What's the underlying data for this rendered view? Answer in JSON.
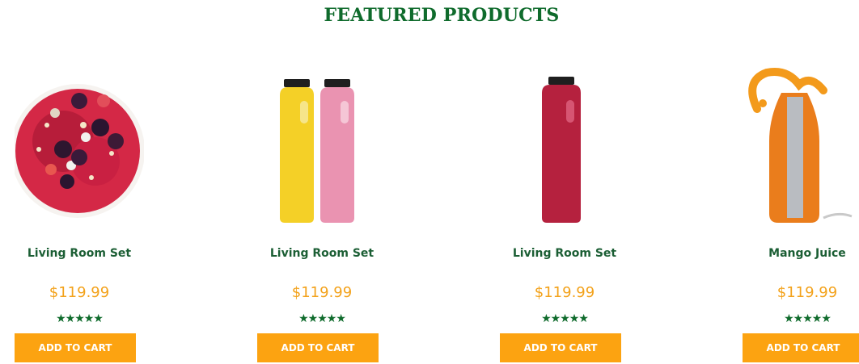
{
  "section": {
    "title": "FEATURED PRODUCTS"
  },
  "products": [
    {
      "name": "Living Room Set",
      "price": "$119.99",
      "rating_stars": 5,
      "rating_display": "★★★★★",
      "cta": "ADD TO CART",
      "image": "berry-smoothie-bowl"
    },
    {
      "name": "Living Room Set",
      "price": "$119.99",
      "rating_stars": 5,
      "rating_display": "★★★★★",
      "cta": "ADD TO CART",
      "image": "yellow-and-pink-juice-bottles"
    },
    {
      "name": "Living Room Set",
      "price": "$119.99",
      "rating_stars": 5,
      "rating_display": "★★★★★",
      "cta": "ADD TO CART",
      "image": "red-juice-bottle"
    },
    {
      "name": "Mango Juice",
      "price": "$119.99",
      "rating_stars": 5,
      "rating_display": "★★★★★",
      "cta": "ADD TO CART",
      "image": "mango-juice-splash-bottle"
    }
  ],
  "colors": {
    "title_green": "#0f6b2c",
    "name_green": "#1b5e34",
    "price_orange": "#f3a21b",
    "button_orange": "#fca311",
    "star_green": "#0f6b2c"
  }
}
